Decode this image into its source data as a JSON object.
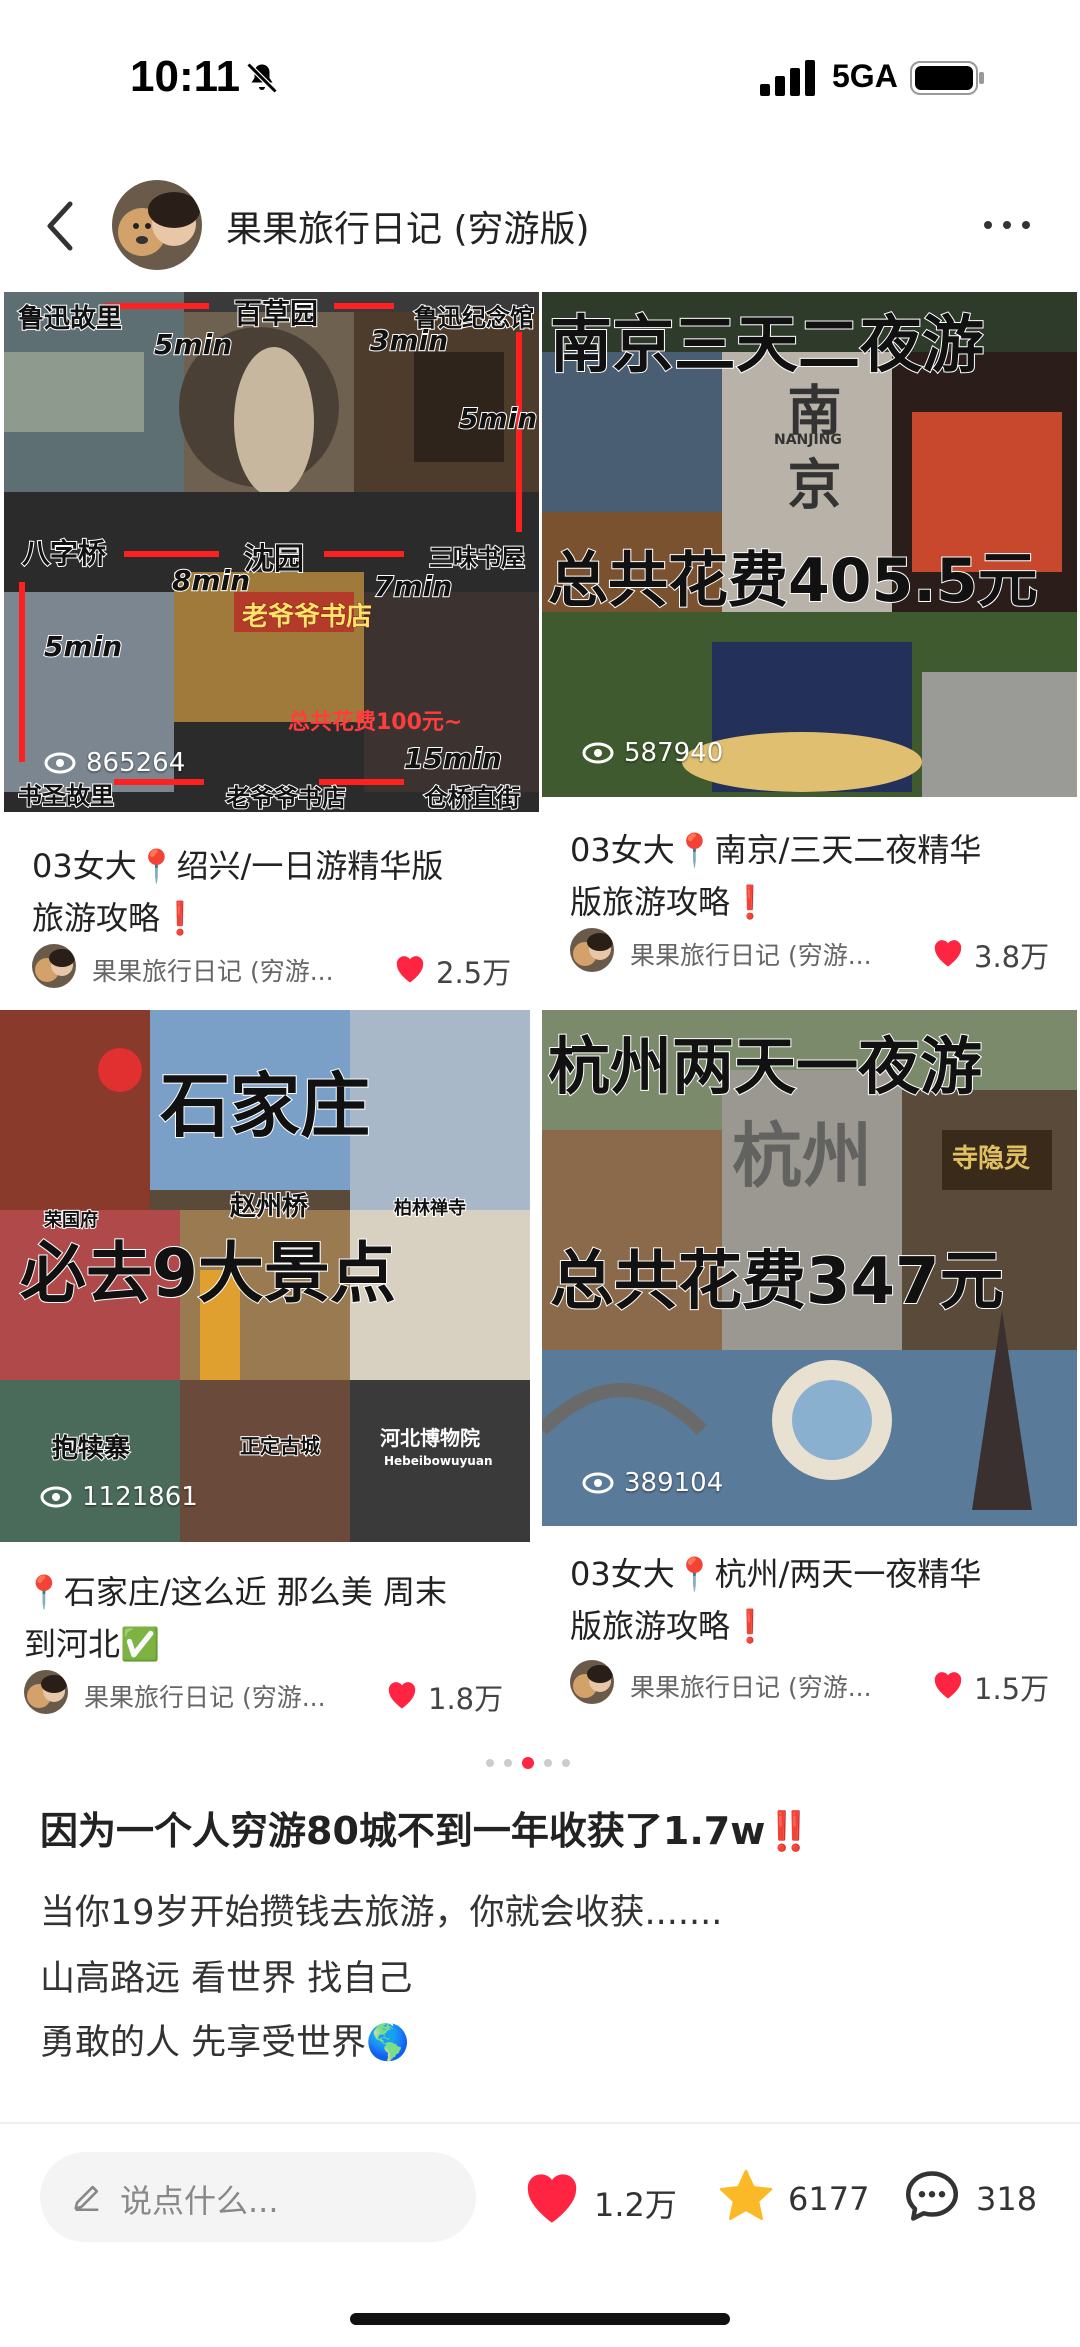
{
  "status_bar": {
    "time": "10:11",
    "network": "5GA"
  },
  "header": {
    "title": "果果旅行日记 (穷游版)"
  },
  "cards": [
    {
      "views": "865264",
      "title_line1": "03女大📍绍兴/一日游精华版",
      "title_line2": "旅游攻略❗",
      "author": "果果旅行日记 (穷游...",
      "likes": "2.5万",
      "image_texts": [
        "鲁迅故里",
        "百草园",
        "鲁迅纪念馆",
        "5min",
        "3min",
        "5min",
        "八字桥",
        "沈园",
        "三味书屋",
        "8min",
        "7min",
        "5min",
        "老爷爷书店",
        "总共花费100元~",
        "15min",
        "书圣故里",
        "老爷爷书店",
        "仓桥直街"
      ]
    },
    {
      "views": "587940",
      "title_line1": "03女大📍南京/三天二夜精华",
      "title_line2": "版旅游攻略❗",
      "author": "果果旅行日记 (穷游...",
      "likes": "3.8万",
      "image_texts": [
        "南京三天二夜游",
        "总共花费405.5元",
        "南京",
        "NANJING"
      ]
    },
    {
      "views": "1121861",
      "title_line1": "📍石家庄/这么近 那么美 周末",
      "title_line2": "到河北✅",
      "author": "果果旅行日记 (穷游...",
      "likes": "1.8万",
      "image_texts": [
        "石家庄",
        "必去9大景点",
        "赵州桥",
        "柏林禅寺",
        "荣国府",
        "抱犊寨",
        "正定古城",
        "河北博物院",
        "Hebeibowuyuan"
      ]
    },
    {
      "views": "389104",
      "title_line1": "03女大📍杭州/两天一夜精华",
      "title_line2": "版旅游攻略❗",
      "author": "果果旅行日记 (穷游...",
      "likes": "1.5万",
      "image_texts": [
        "杭州两天一夜游",
        "总共花费347元",
        "杭州",
        "寺隐灵"
      ]
    }
  ],
  "carousel": {
    "count": 5,
    "active": 3
  },
  "post": {
    "title": "因为一个人穷游80城不到一年收获了1.7w‼️",
    "lines": [
      "当你19岁开始攒钱去旅游，你就会收获.......",
      "山高路远 看世界 找自己",
      "勇敢的人 先享受世界🌎"
    ]
  },
  "bottom_bar": {
    "comment_placeholder": "说点什么...",
    "likes": "1.2万",
    "collects": "6177",
    "comments": "318"
  },
  "colors": {
    "accent": "#ff2442",
    "star": "#fbb928"
  },
  "icons": [
    "bell-slash-icon",
    "signal-icon",
    "battery-icon",
    "back-icon",
    "more-icon",
    "eye-icon",
    "heart-icon",
    "pencil-icon",
    "star-icon",
    "comment-icon"
  ]
}
